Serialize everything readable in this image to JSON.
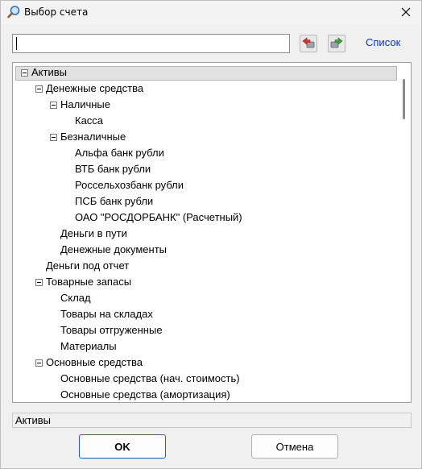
{
  "window": {
    "title": "Выбор счета",
    "title_icon": "magnifier-icon",
    "close_icon": "close-icon"
  },
  "toolbar": {
    "search_value": "",
    "back_icon": "arrow-left-icon",
    "forward_icon": "arrow-right-icon",
    "list_link": "Список",
    "link_color": "#0033cc"
  },
  "tree": {
    "selected_index": 0,
    "nodes": [
      {
        "label": "Активы",
        "level": 0,
        "expanded": true
      },
      {
        "label": "Денежные средства",
        "level": 1,
        "expanded": true
      },
      {
        "label": "Наличные",
        "level": 2,
        "expanded": true
      },
      {
        "label": "Касса",
        "level": 3,
        "expanded": null
      },
      {
        "label": "Безналичные",
        "level": 2,
        "expanded": true
      },
      {
        "label": "Альфа банк рубли",
        "level": 3,
        "expanded": null
      },
      {
        "label": "ВТБ банк рубли",
        "level": 3,
        "expanded": null
      },
      {
        "label": "Россельхозбанк рубли",
        "level": 3,
        "expanded": null
      },
      {
        "label": "ПСБ банк рубли",
        "level": 3,
        "expanded": null
      },
      {
        "label": "ОАО \"РОСДОРБАНК\" (Расчетный)",
        "level": 3,
        "expanded": null
      },
      {
        "label": "Деньги в пути",
        "level": 2,
        "expanded": null
      },
      {
        "label": "Денежные документы",
        "level": 2,
        "expanded": null
      },
      {
        "label": "Деньги под отчет",
        "level": 1,
        "expanded": null
      },
      {
        "label": "Товарные запасы",
        "level": 1,
        "expanded": true
      },
      {
        "label": "Склад",
        "level": 2,
        "expanded": null
      },
      {
        "label": "Товары на складах",
        "level": 2,
        "expanded": null
      },
      {
        "label": "Товары отгруженные",
        "level": 2,
        "expanded": null
      },
      {
        "label": "Материалы",
        "level": 2,
        "expanded": null
      },
      {
        "label": "Основные средства",
        "level": 1,
        "expanded": true
      },
      {
        "label": "Основные средства (нач. стоимость)",
        "level": 2,
        "expanded": null
      },
      {
        "label": "Основные средства (амортизация)",
        "level": 2,
        "expanded": null
      }
    ]
  },
  "status": {
    "text": "Активы"
  },
  "buttons": {
    "ok": "OK",
    "cancel": "Отмена",
    "ok_border_color": "#1c5ec9"
  }
}
